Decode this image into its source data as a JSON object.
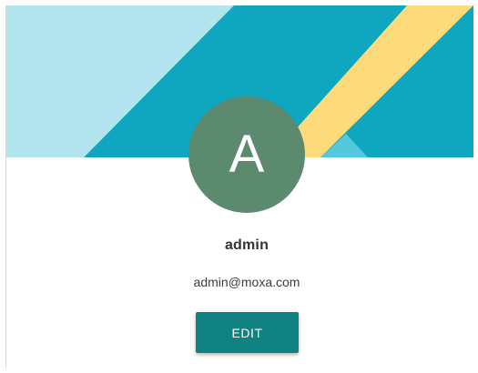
{
  "profile": {
    "avatar_initial": "A",
    "username": "admin",
    "email": "admin@moxa.com",
    "edit_label": "EDIT"
  },
  "colors": {
    "banner_light": "#b3e5ef",
    "banner_teal": "#0fa7c0",
    "banner_stripe": "#fddb7b",
    "banner_accent": "#54c8dc",
    "avatar_bg": "#5b8a6f",
    "button_bg": "#108282"
  },
  "icons": {
    "avatar": "letter-avatar"
  }
}
